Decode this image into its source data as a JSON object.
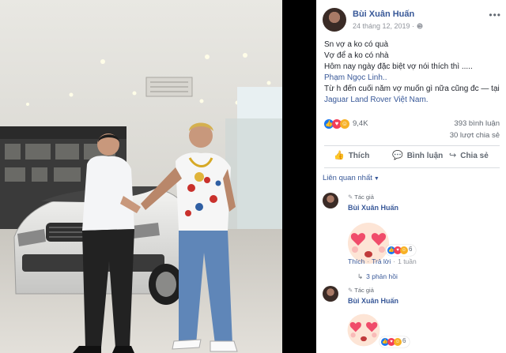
{
  "post": {
    "author": "Bùi Xuân Huấn",
    "date": "24 tháng 12, 2019",
    "audience_icon": "globe-icon",
    "more_icon": "ellipsis-icon",
    "lines": [
      "Sn vợ a ko có quà",
      "Vợ để a ko có nhà",
      "Hôm nay ngày đặc biệt vợ nói thích thì .....",
      "Phạm Ngọc Linh..",
      "Từ h đến cuối năm vợ muốn gì nữa cũng đc",
      "— tại",
      "Jaguar Land Rover Việt Nam."
    ]
  },
  "stats": {
    "reaction_count": "9,4K",
    "comment_count": "393 bình luận",
    "share_count": "30 lượt chia sẻ"
  },
  "actions": {
    "like": "Thích",
    "comment": "Bình luận",
    "share": "Chia sẻ"
  },
  "sort_label": "Liên quan nhất",
  "comments": [
    {
      "badge": "Tác giả",
      "author": "Bùi Xuân Huấn",
      "reaction_count": "6",
      "like": "Thích",
      "reply": "Trả lời",
      "age": "1 tuần",
      "replies": "3 phản hồi"
    },
    {
      "badge": "Tác giả",
      "author": "Bùi Xuân Huấn",
      "reaction_count": "6"
    }
  ],
  "colors": {
    "link": "#385898",
    "secondary_text": "#90949c",
    "like_blue": "#1877f2",
    "love_red": "#f33e58",
    "haha_yellow": "#f7b125"
  }
}
